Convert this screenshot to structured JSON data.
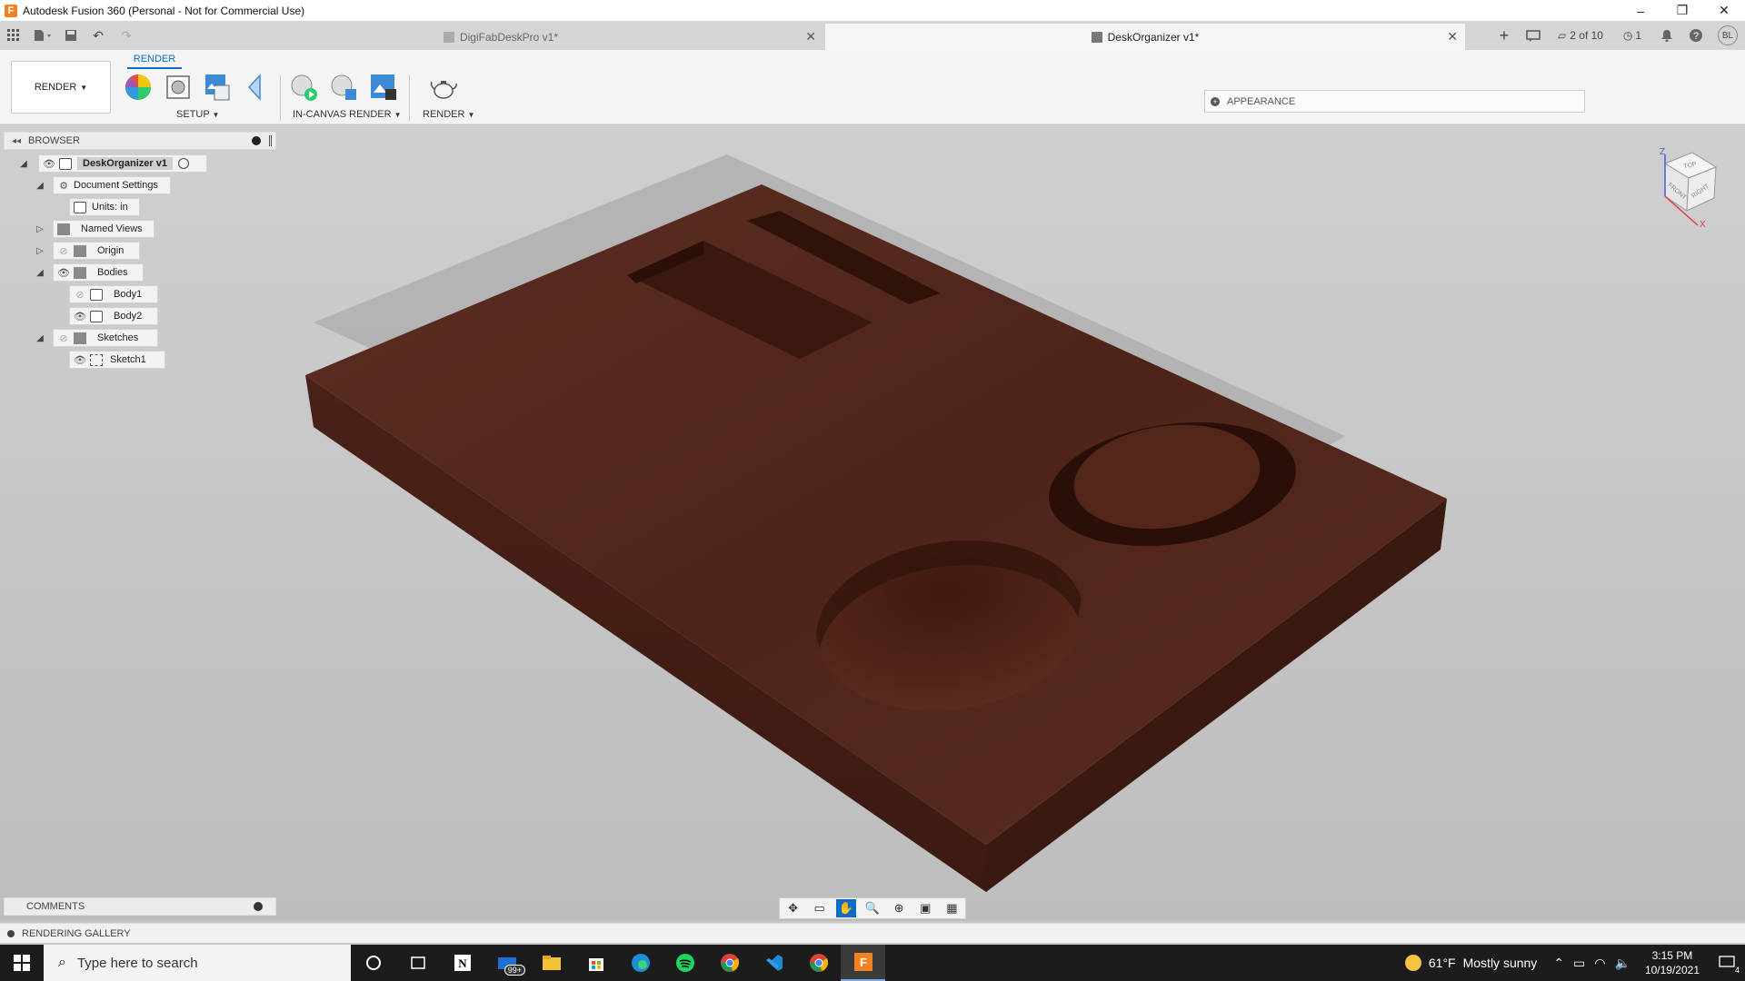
{
  "window": {
    "title": "Autodesk Fusion 360 (Personal - Not for Commercial Use)",
    "app_logo": "F",
    "minimize": "–",
    "restore": "❐",
    "close": "✕"
  },
  "tabs": [
    {
      "label": "DigiFabDeskPro v1*",
      "active": false
    },
    {
      "label": "DeskOrganizer v1*",
      "active": true
    }
  ],
  "header_tools": {
    "job_status": "2 of 10",
    "clock_count": "1",
    "user_initials": "BL"
  },
  "toolbar": {
    "workspace": "RENDER",
    "active_tab": "RENDER",
    "groups": [
      "SETUP",
      "IN-CANVAS RENDER",
      "RENDER"
    ],
    "appearance_label": "APPEARANCE"
  },
  "browser": {
    "title": "BROWSER",
    "root": "DeskOrganizer v1",
    "items": [
      {
        "label": "Document Settings"
      },
      {
        "label": "Units: in"
      },
      {
        "label": "Named Views"
      },
      {
        "label": "Origin"
      },
      {
        "label": "Bodies"
      },
      {
        "label": "Body1"
      },
      {
        "label": "Body2"
      },
      {
        "label": "Sketches"
      },
      {
        "label": "Sketch1"
      }
    ]
  },
  "viewcube": {
    "top": "TOP",
    "front": "FRONT",
    "right": "RIGHT",
    "axis_x": "X",
    "axis_z": "Z"
  },
  "comments_label": "COMMENTS",
  "gallery_label": "RENDERING GALLERY",
  "taskbar": {
    "search_placeholder": "Type here to search",
    "mail_badge": "99+",
    "weather_temp": "61°F",
    "weather_text": "Mostly sunny",
    "time": "3:15 PM",
    "date": "10/19/2021",
    "notification_count": "4"
  },
  "colors": {
    "accent": "#0a6cc4",
    "wood": "#5a2b1f",
    "fusion_orange": "#f58220"
  }
}
